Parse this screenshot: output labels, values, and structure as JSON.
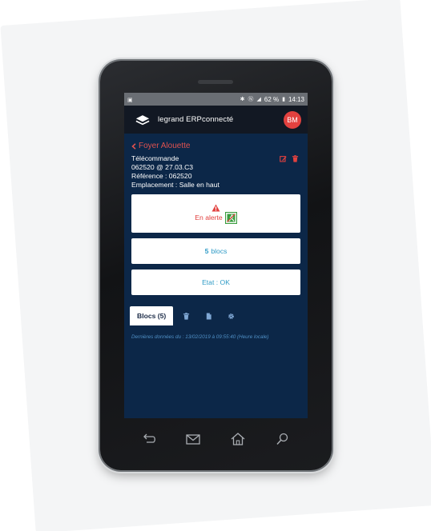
{
  "status_bar": {
    "time": "14:13",
    "battery": "62 %",
    "left_icon": "image-icon",
    "right_icons": [
      "bluetooth-icon",
      "nfc-icon",
      "signal-icon",
      "battery-icon"
    ]
  },
  "header": {
    "app_name": "legrand ERPconnecté",
    "logo": "legrand-logo-icon",
    "avatar_initials": "BM"
  },
  "breadcrumb": {
    "label": "Foyer Alouette",
    "icon": "chevron-left-icon"
  },
  "device": {
    "name": "Télécommande",
    "id_line": "062520 @ 27.03.C3",
    "reference": "Référence : 062520",
    "location": "Emplacement : Salle en haut"
  },
  "cards": {
    "alert_label": "En alerte",
    "blocks_count": "5",
    "blocks_label": "blocs",
    "state_label": "Etat : OK"
  },
  "tabs": {
    "active_label": "Blocs (5)",
    "icons": [
      "trash-icon",
      "document-icon",
      "gear-icon"
    ]
  },
  "footer_note": "Dernières données du : 13/02/2019 à 09:55:40 (Heure locale)",
  "colors": {
    "screen_bg": "#0c2748",
    "accent_red": "#e2413f",
    "accent_blue": "#2f9bc6",
    "alert_green": "#3a9c3f"
  }
}
